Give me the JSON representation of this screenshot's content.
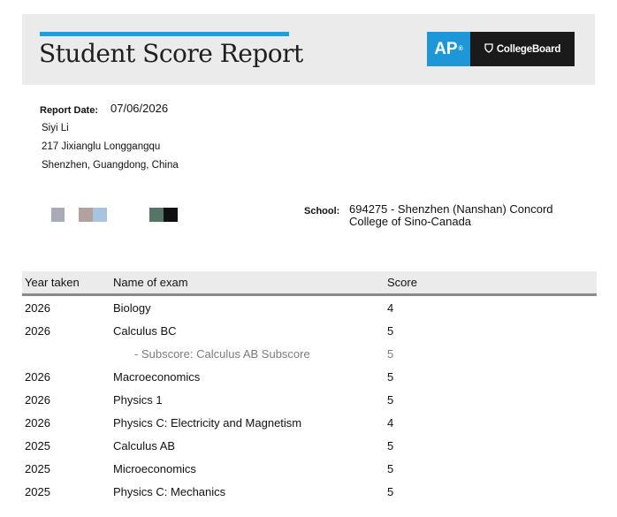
{
  "header": {
    "title": "Student Score Report",
    "logo_ap": "AP",
    "logo_cb": "CollegeBoard"
  },
  "report": {
    "date_label": "Report Date:",
    "date": "07/06/2026",
    "name": "Siyi Li",
    "address_line1": "217 Jixianglu Longgangqu",
    "address_line2": "Shenzhen, Guangdong, China"
  },
  "school": {
    "label": "School:",
    "value": "694275 - Shenzhen (Nanshan) Concord College of Sino-Canada"
  },
  "colors": {
    "accent": "#1aa0dc",
    "ap_blue": "#1e97d8",
    "header_band": "#ebebeb",
    "swatches": [
      "#a9abb7",
      "#b3a1a0",
      "#a8c4e0",
      "#557566",
      "#111111"
    ]
  },
  "table": {
    "headers": [
      "Year taken",
      "Name of exam",
      "Score"
    ],
    "rows": [
      {
        "year": "2026",
        "exam": "Biology",
        "score": "4"
      },
      {
        "year": "2026",
        "exam": "Calculus BC",
        "score": "5"
      },
      {
        "year": "",
        "exam": "- Subscore: Calculus AB Subscore",
        "score": "5",
        "subscore": true
      },
      {
        "year": "2026",
        "exam": "Macroeconomics",
        "score": "5"
      },
      {
        "year": "2026",
        "exam": "Physics 1",
        "score": "5"
      },
      {
        "year": "2026",
        "exam": "Physics C: Electricity and Magnetism",
        "score": "4"
      },
      {
        "year": "2025",
        "exam": "Calculus AB",
        "score": "5"
      },
      {
        "year": "2025",
        "exam": "Microeconomics",
        "score": "5"
      },
      {
        "year": "2025",
        "exam": "Physics C: Mechanics",
        "score": "5"
      }
    ]
  }
}
